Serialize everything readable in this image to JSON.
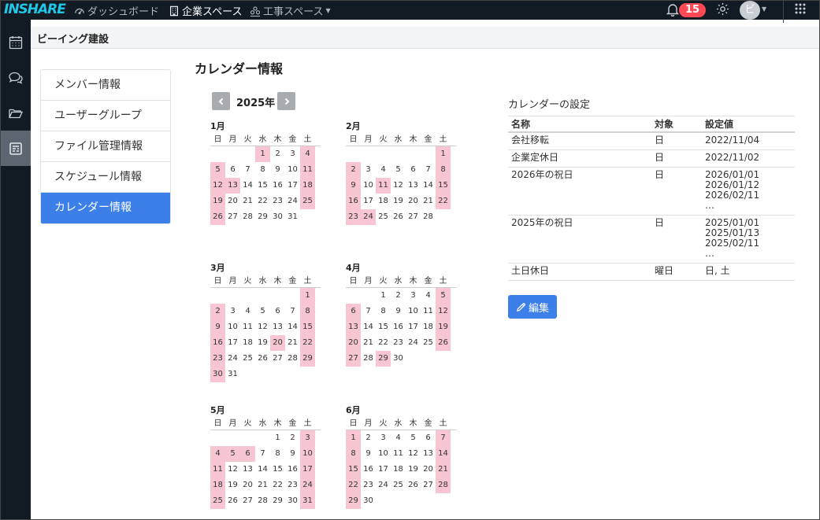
{
  "topbar": {
    "logo": "INSHARE",
    "nav": [
      {
        "label": "ダッシュボード",
        "icon": "dashboard-icon"
      },
      {
        "label": "企業スペース",
        "icon": "building-icon"
      },
      {
        "label": "工事スペース",
        "icon": "workers-icon"
      }
    ],
    "notification_count": "15",
    "avatar_initial": "ビ"
  },
  "company": {
    "name": "ビーイング建設"
  },
  "menu": {
    "items": [
      {
        "label": "メンバー情報"
      },
      {
        "label": "ユーザーグループ"
      },
      {
        "label": "ファイル管理情報"
      },
      {
        "label": "スケジュール情報"
      },
      {
        "label": "カレンダー情報"
      }
    ],
    "active_index": 4
  },
  "page": {
    "title": "カレンダー情報"
  },
  "calendar": {
    "year_label": "2025年",
    "weekdays": [
      "日",
      "月",
      "火",
      "水",
      "木",
      "金",
      "土"
    ],
    "months": [
      {
        "name": "1月",
        "start": 3,
        "days": 31,
        "holidays": [
          1,
          4,
          5,
          11,
          12,
          13,
          18,
          19,
          25,
          26
        ]
      },
      {
        "name": "2月",
        "start": 6,
        "days": 28,
        "holidays": [
          1,
          2,
          8,
          9,
          11,
          15,
          16,
          22,
          23,
          24
        ]
      },
      {
        "name": "3月",
        "start": 6,
        "days": 31,
        "holidays": [
          1,
          2,
          8,
          9,
          15,
          16,
          20,
          22,
          23,
          29,
          30
        ]
      },
      {
        "name": "4月",
        "start": 2,
        "days": 30,
        "holidays": [
          5,
          6,
          12,
          13,
          19,
          20,
          26,
          27,
          29
        ]
      },
      {
        "name": "5月",
        "start": 4,
        "days": 31,
        "holidays": [
          3,
          4,
          5,
          6,
          10,
          11,
          17,
          18,
          24,
          25,
          31
        ]
      },
      {
        "name": "6月",
        "start": 0,
        "days": 30,
        "holidays": [
          1,
          7,
          8,
          14,
          15,
          21,
          22,
          28,
          29
        ]
      }
    ]
  },
  "settings": {
    "title": "カレンダーの設定",
    "headers": {
      "name": "名称",
      "target": "対象",
      "value": "設定値"
    },
    "rows": [
      {
        "name": "会社移転",
        "target": "日",
        "value": "2022/11/04"
      },
      {
        "name": "企業定休日",
        "target": "日",
        "value": "2022/11/02"
      },
      {
        "name": "2026年の祝日",
        "target": "日",
        "value": "2026/01/01\n2026/01/12\n2026/02/11\n…"
      },
      {
        "name": "2025年の祝日",
        "target": "日",
        "value": "2025/01/01\n2025/01/13\n2025/02/11\n…"
      },
      {
        "name": "土日休日",
        "target": "曜日",
        "value": "日, 土"
      }
    ],
    "edit_label": "編集"
  },
  "colors": {
    "topbar": "#121a24",
    "accent": "#3d7fe8",
    "holiday": "#f8c6d2",
    "badge": "#ff4a55",
    "logo": "#1ec8e6"
  }
}
